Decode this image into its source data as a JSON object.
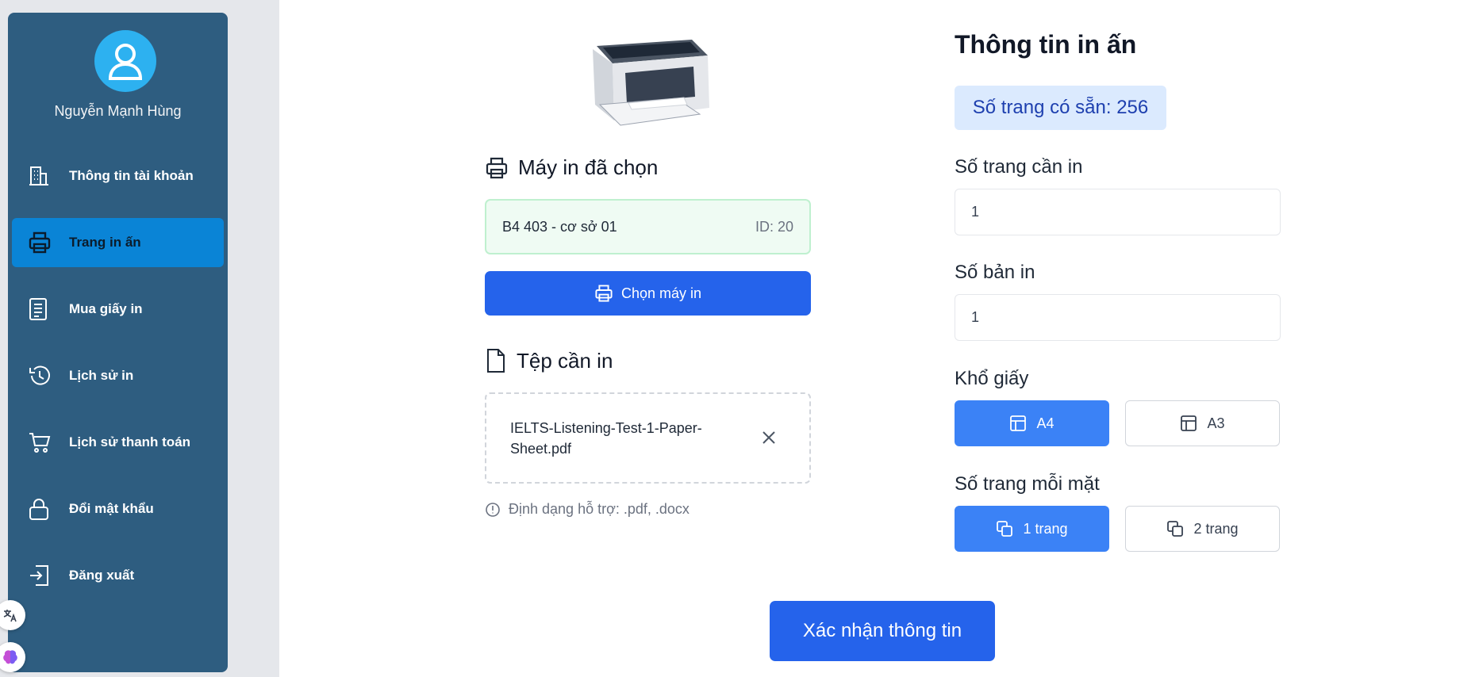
{
  "sidebar": {
    "user_name": "Nguyễn Mạnh Hùng",
    "items": [
      {
        "label": "Thông tin tài khoản",
        "icon": "building-icon"
      },
      {
        "label": "Trang in ấn",
        "icon": "printer-icon",
        "active": true
      },
      {
        "label": "Mua giấy in",
        "icon": "document-icon"
      },
      {
        "label": "Lịch sử in",
        "icon": "history-icon"
      },
      {
        "label": "Lịch sử thanh toán",
        "icon": "cart-icon"
      },
      {
        "label": "Đổi mật khẩu",
        "icon": "lock-icon"
      },
      {
        "label": "Đăng xuất",
        "icon": "logout-icon"
      }
    ],
    "accent": "#2e5d80",
    "active_color": "#0a84d6"
  },
  "printer_section": {
    "title": "Máy in đã chọn",
    "selected_name": "B4 403 - cơ sở 01",
    "selected_id": "ID: 20",
    "choose_button": "Chọn máy in"
  },
  "file_section": {
    "title": "Tệp cần in",
    "file_name": "IELTS-Listening-Test-1-Paper-Sheet.pdf",
    "hint": "Định dạng hỗ trợ: .pdf, .docx"
  },
  "print_info": {
    "title": "Thông tin in ấn",
    "available_pages": "Số trang có sẵn: 256",
    "pages_label": "Số trang cần in",
    "pages_value": "1",
    "copies_label": "Số bản in",
    "copies_value": "1",
    "paper_size_label": "Khổ giấy",
    "paper_sizes": [
      {
        "label": "A4",
        "selected": true
      },
      {
        "label": "A3",
        "selected": false
      }
    ],
    "pages_per_side_label": "Số trang mỗi mặt",
    "pages_per_side": [
      {
        "label": "1 trang",
        "selected": true
      },
      {
        "label": "2 trang",
        "selected": false
      }
    ]
  },
  "confirm_button": "Xác nhận thông tin",
  "colors": {
    "primary": "#2563eb",
    "selected_option": "#3b82f6",
    "badge_bg": "#dbeafe",
    "badge_text": "#1e40af"
  }
}
